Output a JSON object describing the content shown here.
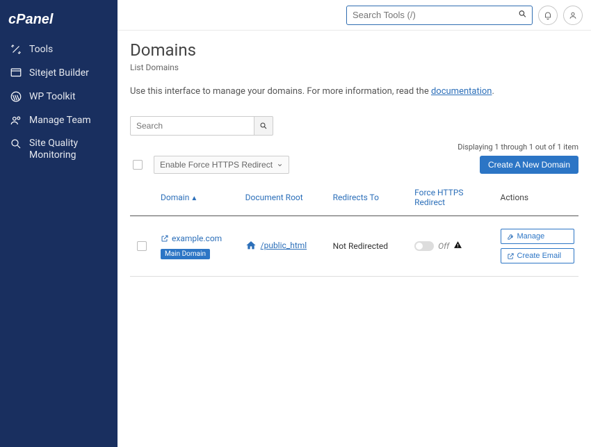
{
  "brand": "cPanel",
  "sidebar": {
    "items": [
      {
        "label": "Tools",
        "icon": "tools-icon"
      },
      {
        "label": "Sitejet Builder",
        "icon": "sitejet-icon"
      },
      {
        "label": "WP Toolkit",
        "icon": "wordpress-icon"
      },
      {
        "label": "Manage Team",
        "icon": "team-icon"
      },
      {
        "label": "Site Quality Monitoring",
        "icon": "magnify-icon"
      }
    ]
  },
  "topbar": {
    "search_placeholder": "Search Tools (/)"
  },
  "page": {
    "title": "Domains",
    "breadcrumb": "List Domains",
    "description_prefix": "Use this interface to manage your domains. For more information, read the ",
    "description_link": "documentation",
    "description_suffix": "."
  },
  "toolbar": {
    "search_placeholder": "Search",
    "https_button": "Enable Force HTTPS Redirect",
    "create_button": "Create A New Domain",
    "displaying_text": "Displaying 1 through 1 out of 1 item"
  },
  "table": {
    "headers": {
      "domain": "Domain",
      "document_root": "Document Root",
      "redirects_to": "Redirects To",
      "force_https": "Force HTTPS Redirect",
      "actions": "Actions"
    },
    "row": {
      "domain": "example.com",
      "badge": "Main Domain",
      "document_root": "/public_html",
      "redirects_to": "Not Redirected",
      "https_state": "Off",
      "manage_label": "Manage",
      "create_email_label": "Create Email"
    }
  }
}
